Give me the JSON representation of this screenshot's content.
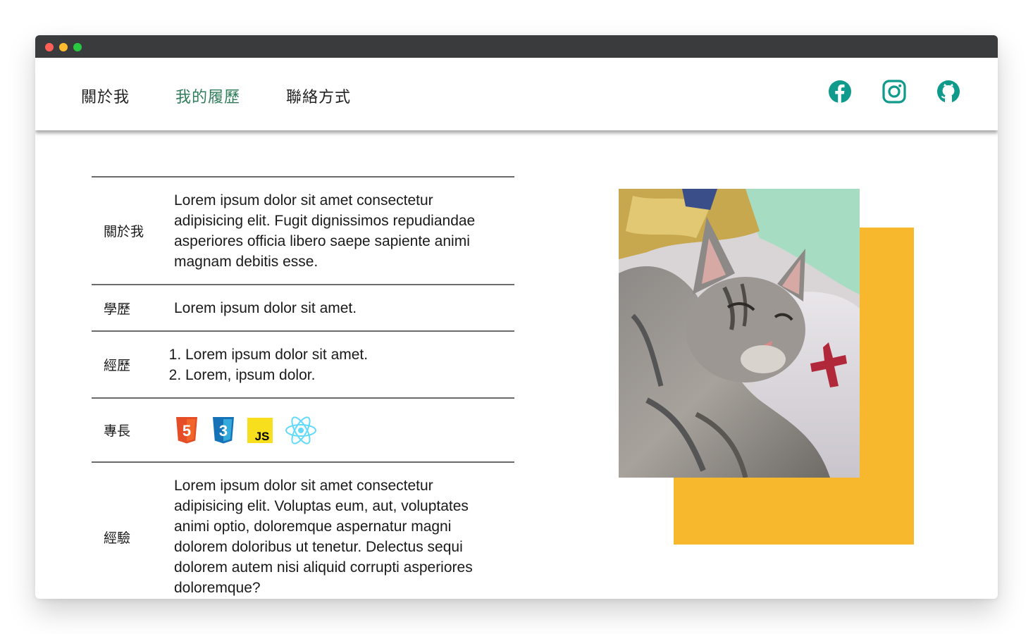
{
  "nav": {
    "items": [
      {
        "label": "關於我",
        "active": false
      },
      {
        "label": "我的履歷",
        "active": true
      },
      {
        "label": "聯絡方式",
        "active": false
      }
    ],
    "active_color": "#2f7d5b",
    "social": [
      {
        "icon": "facebook-icon"
      },
      {
        "icon": "instagram-icon"
      },
      {
        "icon": "github-icon"
      }
    ],
    "social_color": "#0f9a8c"
  },
  "resume": {
    "about": {
      "label": "關於我",
      "text": "Lorem ipsum dolor sit amet consectetur adipisicing elit. Fugit dignissimos repudiandae asperiores officia libero saepe sapiente animi magnam debitis esse."
    },
    "education": {
      "label": "學歷",
      "text": "Lorem ipsum dolor sit amet."
    },
    "work": {
      "label": "經歷",
      "items": [
        "Lorem ipsum dolor sit amet.",
        "Lorem, ipsum dolor."
      ]
    },
    "skills": {
      "label": "專長",
      "icons": [
        "html5-icon",
        "css3-icon",
        "javascript-icon",
        "react-icon"
      ],
      "html5_text": "5",
      "css3_text": "3",
      "js_text": "JS"
    },
    "experience": {
      "label": "經驗",
      "text": "Lorem ipsum dolor sit amet consectetur adipisicing elit. Voluptas eum, aut, voluptates animi optio, doloremque aspernatur magni dolorem doloribus ut tenetur. Delectus sequi dolorem autem nisi aliquid corrupti asperiores doloremque?"
    }
  },
  "photo": {
    "accent_color": "#f8b82e",
    "image": "cat-photo"
  }
}
